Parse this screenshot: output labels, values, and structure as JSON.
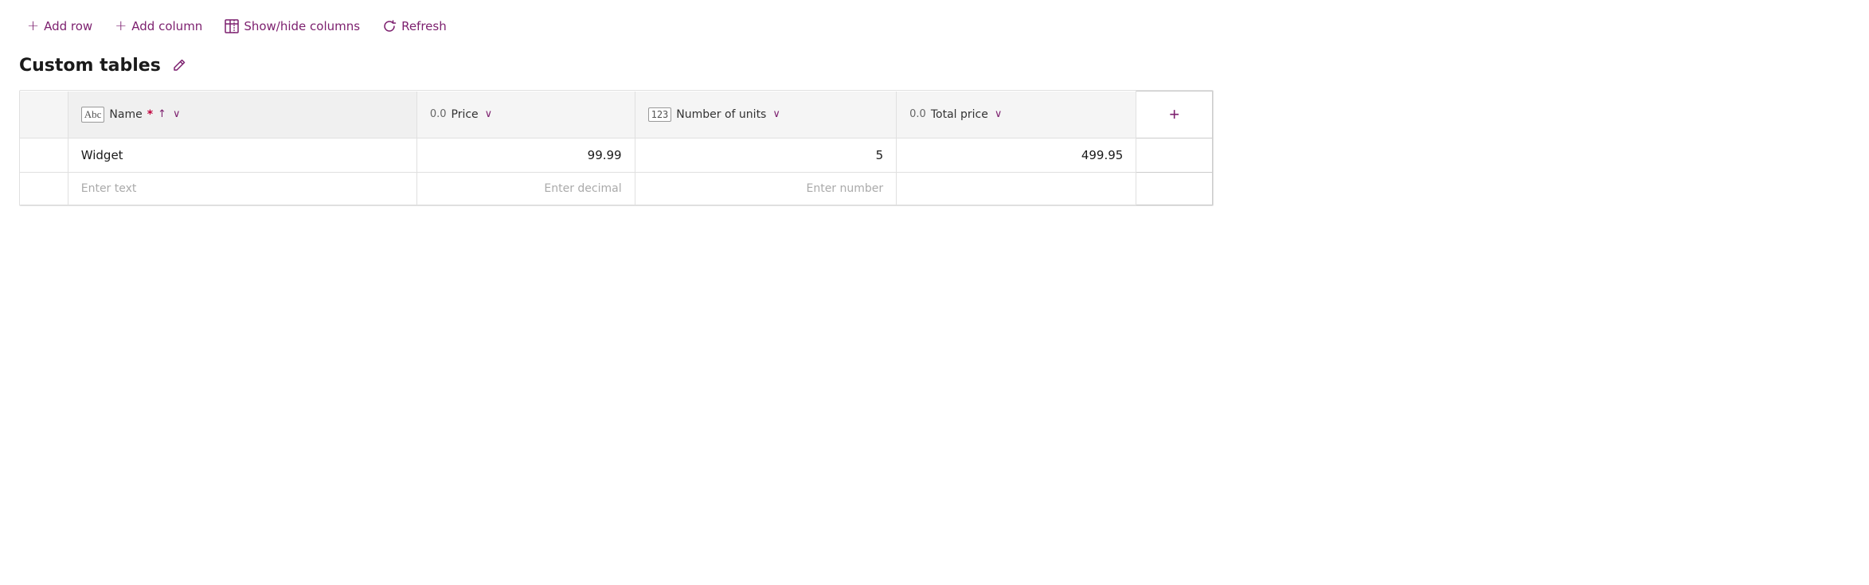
{
  "toolbar": {
    "add_row_label": "Add row",
    "add_column_label": "Add column",
    "show_hide_label": "Show/hide columns",
    "refresh_label": "Refresh"
  },
  "page": {
    "title": "Custom tables"
  },
  "table": {
    "columns": [
      {
        "id": "name",
        "icon_type": "abc",
        "icon_label": "Abc",
        "prefix": "",
        "label": "Name",
        "required": true,
        "sortable": true,
        "has_chevron": true
      },
      {
        "id": "price",
        "icon_type": "decimal",
        "icon_label": "0.0",
        "prefix": "",
        "label": "Price",
        "required": false,
        "sortable": false,
        "has_chevron": true
      },
      {
        "id": "units",
        "icon_type": "number",
        "icon_label": "123",
        "prefix": "",
        "label": "Number of units",
        "required": false,
        "sortable": false,
        "has_chevron": true
      },
      {
        "id": "total",
        "icon_type": "decimal",
        "icon_label": "0.0",
        "prefix": "",
        "label": "Total price",
        "required": false,
        "sortable": false,
        "has_chevron": true
      }
    ],
    "rows": [
      {
        "name": "Widget",
        "price": "99.99",
        "units": "5",
        "total": "499.95"
      }
    ],
    "new_row_placeholders": {
      "name": "Enter text",
      "price": "Enter decimal",
      "units": "Enter number",
      "total": ""
    },
    "add_column_label": "+"
  }
}
